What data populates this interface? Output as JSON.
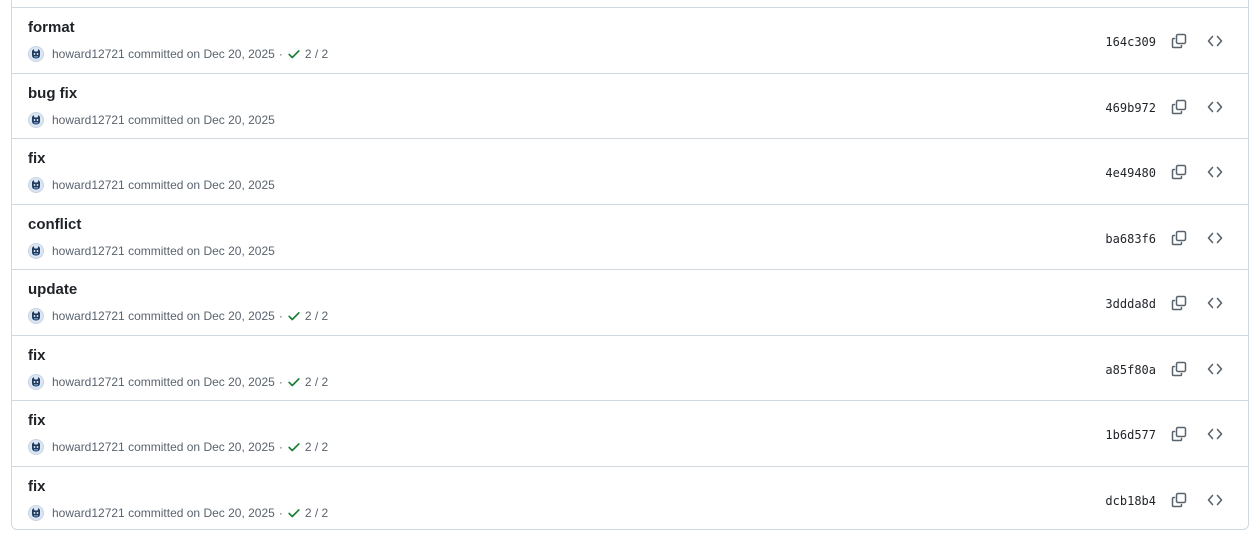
{
  "commits": [
    {
      "title": "format",
      "author": "howard12721",
      "date_text": "committed on Dec 20, 2025",
      "checks": "2 / 2",
      "has_checks": true,
      "sha": "164c309"
    },
    {
      "title": "bug fix",
      "author": "howard12721",
      "date_text": "committed on Dec 20, 2025",
      "checks": "",
      "has_checks": false,
      "sha": "469b972"
    },
    {
      "title": "fix",
      "author": "howard12721",
      "date_text": "committed on Dec 20, 2025",
      "checks": "",
      "has_checks": false,
      "sha": "4e49480"
    },
    {
      "title": "conflict",
      "author": "howard12721",
      "date_text": "committed on Dec 20, 2025",
      "checks": "",
      "has_checks": false,
      "sha": "ba683f6"
    },
    {
      "title": "update",
      "author": "howard12721",
      "date_text": "committed on Dec 20, 2025",
      "checks": "2 / 2",
      "has_checks": true,
      "sha": "3ddda8d"
    },
    {
      "title": "fix",
      "author": "howard12721",
      "date_text": "committed on Dec 20, 2025",
      "checks": "2 / 2",
      "has_checks": true,
      "sha": "a85f80a"
    },
    {
      "title": "fix",
      "author": "howard12721",
      "date_text": "committed on Dec 20, 2025",
      "checks": "2 / 2",
      "has_checks": true,
      "sha": "1b6d577"
    },
    {
      "title": "fix",
      "author": "howard12721",
      "date_text": "committed on Dec 20, 2025",
      "checks": "2 / 2",
      "has_checks": true,
      "sha": "dcb18b4"
    }
  ],
  "separator": "·",
  "icons": {
    "avatar": "avatar-icon",
    "check": "check-icon",
    "copy": "copy-icon",
    "browse": "code-icon"
  },
  "colors": {
    "check_green": "#1a7f37",
    "border": "#d1d9e0",
    "muted": "#59636e"
  }
}
